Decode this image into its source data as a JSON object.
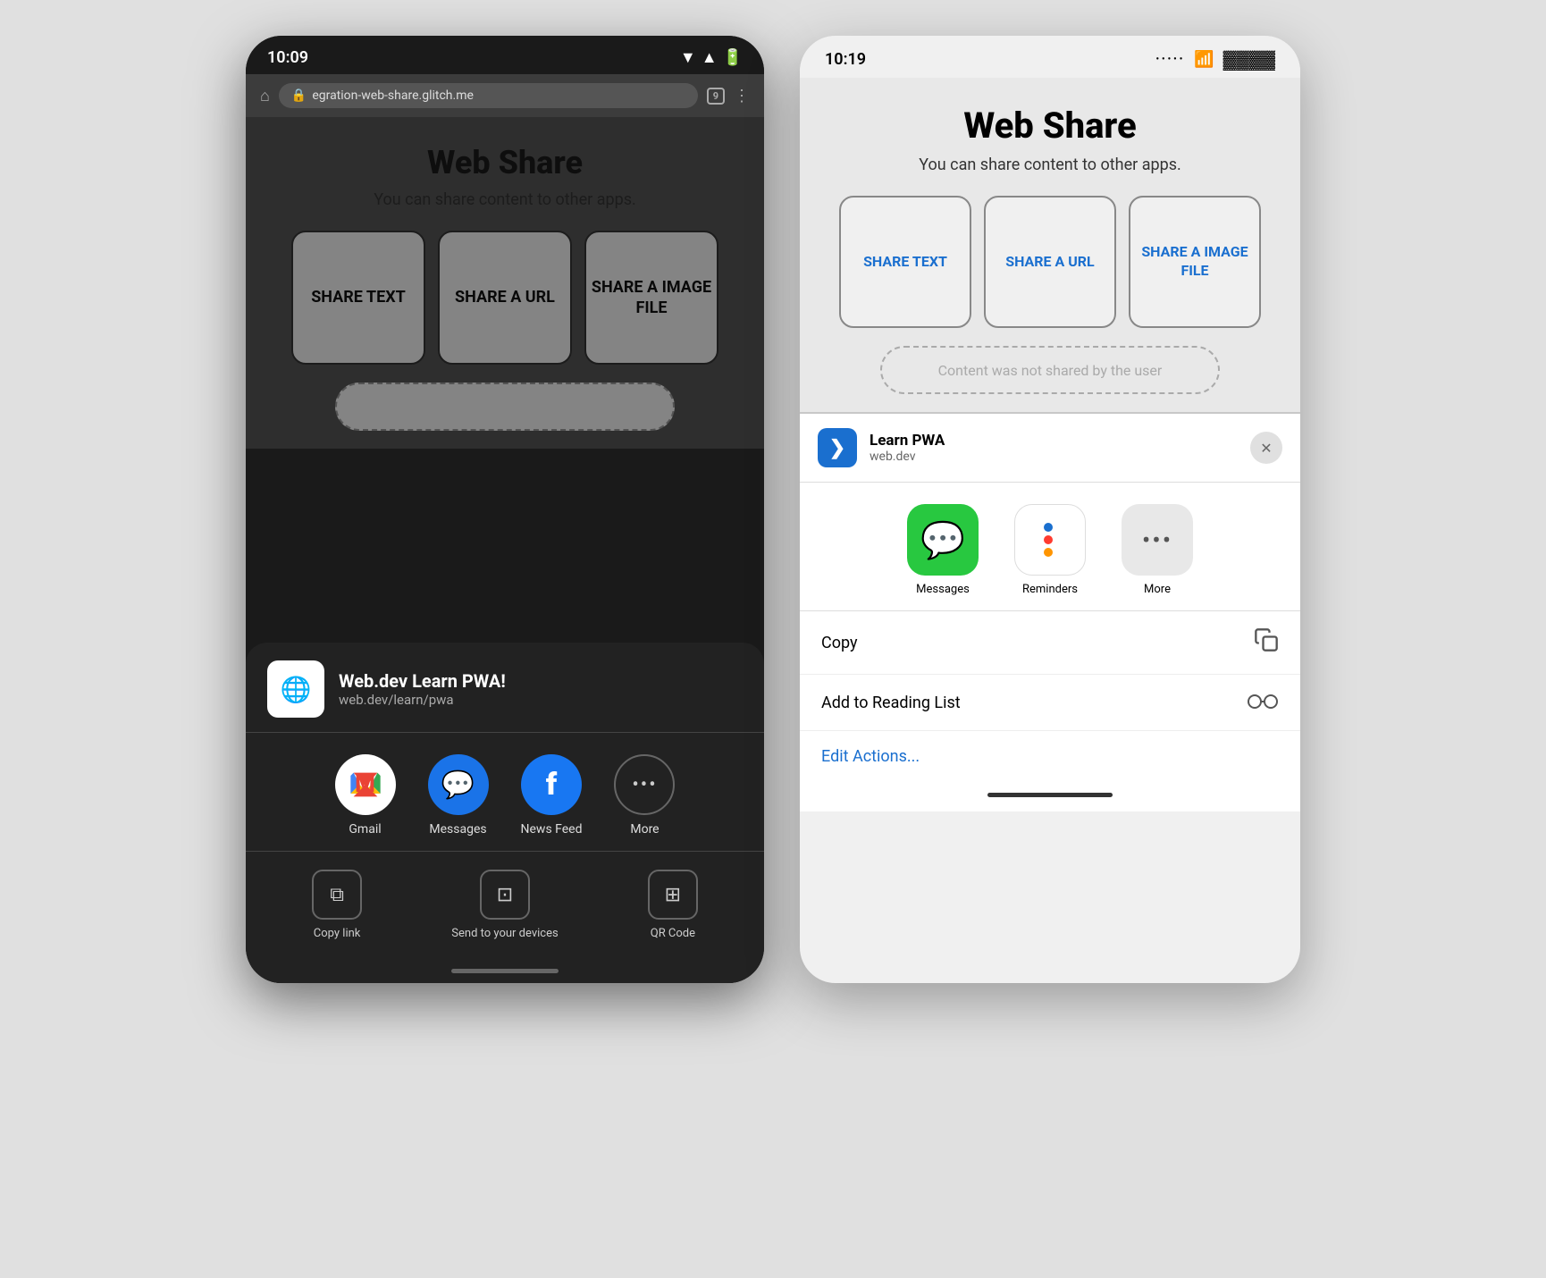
{
  "left_phone": {
    "statusbar": {
      "time": "10:09",
      "tabs_count": "9"
    },
    "urlbar": {
      "address": "egration-web-share.glitch.me"
    },
    "web_content": {
      "title": "Web Share",
      "subtitle": "You can share content to other apps.",
      "btn1": "SHARE TEXT",
      "btn2": "SHARE A URL",
      "btn3": "SHARE A IMAGE FILE"
    },
    "sharesheet": {
      "app_icon": "🌐",
      "title": "Web.dev Learn PWA!",
      "url": "web.dev/learn/pwa",
      "apps": [
        {
          "label": "Gmail",
          "icon": "M"
        },
        {
          "label": "Messages",
          "icon": "💬"
        },
        {
          "label": "News Feed",
          "icon": "f"
        },
        {
          "label": "More",
          "icon": "..."
        }
      ],
      "actions": [
        {
          "label": "Copy link",
          "icon": "⧉"
        },
        {
          "label": "Send to your devices",
          "icon": "⊡"
        },
        {
          "label": "QR Code",
          "icon": "⊞"
        }
      ]
    }
  },
  "right_phone": {
    "statusbar": {
      "time": "10:19"
    },
    "web_content": {
      "title": "Web Share",
      "subtitle": "You can share content to other apps.",
      "btn1": "SHARE TEXT",
      "btn2": "SHARE A URL",
      "btn3": "SHARE A IMAGE FILE",
      "status_placeholder": "Content was not shared by the user"
    },
    "sharesheet": {
      "app_name": "Learn PWA",
      "domain": "web.dev",
      "apps": [
        {
          "label": "Messages"
        },
        {
          "label": "Reminders"
        },
        {
          "label": "More"
        }
      ],
      "actions": [
        {
          "label": "Copy",
          "icon": "copy"
        },
        {
          "label": "Add to Reading List",
          "icon": "glasses"
        }
      ],
      "edit_actions": "Edit Actions..."
    }
  }
}
